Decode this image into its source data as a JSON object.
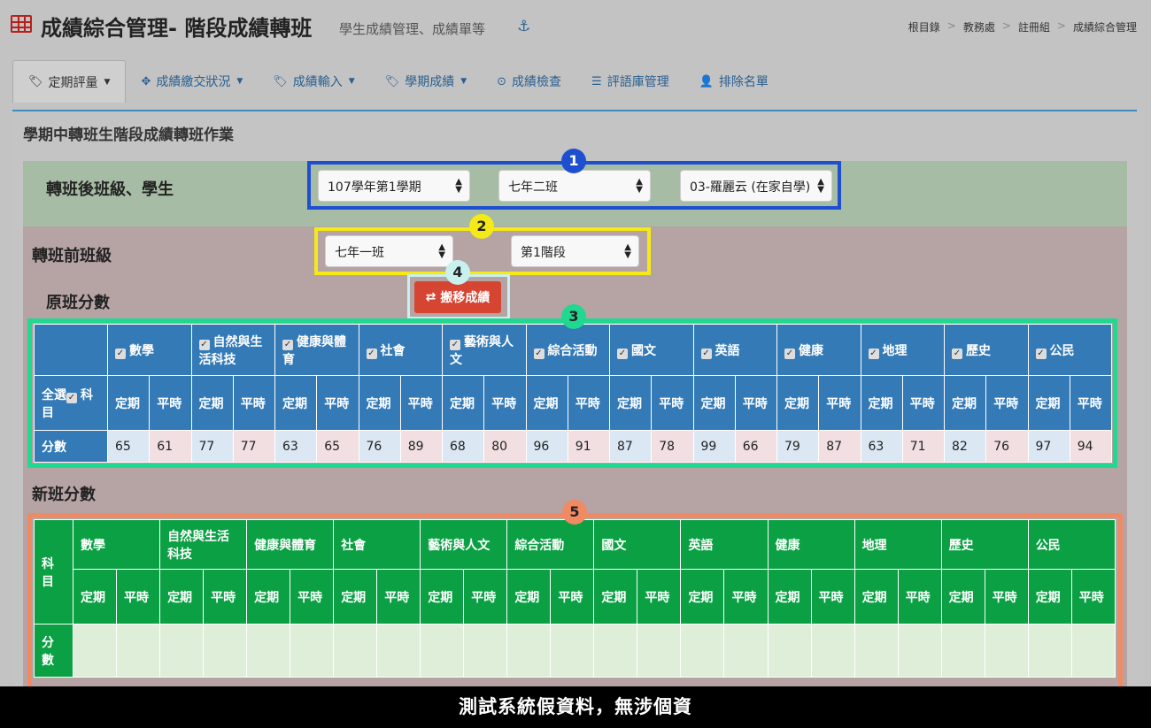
{
  "header": {
    "title": "成績綜合管理- 階段成績轉班",
    "subtitle": "學生成績管理、成績單等",
    "anchor_icon": "anchor-icon",
    "breadcrumb": [
      "根目錄",
      "教務處",
      "註冊組",
      "成績綜合管理"
    ]
  },
  "tabs": [
    {
      "label": "定期評量",
      "icon": "tags-icon",
      "dropdown": true,
      "active": true
    },
    {
      "label": "成績繳交狀況",
      "icon": "crosshairs-icon",
      "dropdown": true
    },
    {
      "label": "成績輸入",
      "icon": "tags-icon",
      "dropdown": true
    },
    {
      "label": "學期成績",
      "icon": "tags-icon",
      "dropdown": true
    },
    {
      "label": "成績檢查",
      "icon": "check-circle-icon",
      "dropdown": false
    },
    {
      "label": "評語庫管理",
      "icon": "database-icon",
      "dropdown": false
    },
    {
      "label": "排除名單",
      "icon": "user-times-icon",
      "dropdown": false
    }
  ],
  "panel": {
    "title": "學期中轉班生階段成績轉班作業",
    "after_label": "轉班後班級、學生",
    "after_selects": [
      "107學年第1學期",
      "七年二班",
      "03-羅麗云 (在家自學)"
    ],
    "before_label": "轉班前班級",
    "before_selects": [
      "七年一班",
      "第1階段"
    ],
    "move_button": "搬移成績",
    "original_label": "原班分數",
    "new_label": "新班分數"
  },
  "badges": [
    "1",
    "2",
    "3",
    "4",
    "5"
  ],
  "original_table": {
    "select_all": "全選",
    "subject_header": "科目",
    "score_label": "分數",
    "subjects": [
      "數學",
      "自然與生活科技",
      "健康與體育",
      "社會",
      "藝術與人文",
      "綜合活動",
      "國文",
      "英語",
      "健康",
      "地理",
      "歷史",
      "公民"
    ],
    "sub_headers": [
      "定期",
      "平時"
    ],
    "scores": [
      65,
      61,
      77,
      77,
      63,
      65,
      76,
      89,
      68,
      80,
      96,
      91,
      87,
      78,
      99,
      66,
      79,
      87,
      63,
      71,
      82,
      76,
      97,
      94
    ]
  },
  "new_table": {
    "subject_header": "科目",
    "score_label": "分數",
    "subjects": [
      "數學",
      "自然與生活科技",
      "健康與體育",
      "社會",
      "藝術與人文",
      "綜合活動",
      "國文",
      "英語",
      "健康",
      "地理",
      "歷史",
      "公民"
    ],
    "sub_headers": [
      "定期",
      "平時"
    ]
  },
  "footer_note": "測試系統假資料，無涉個資",
  "colors": {
    "box1": "#1f4fd1",
    "box2": "#f5ea16",
    "box3": "#1ed98f",
    "box4": "#c8f0ef",
    "box5": "#f08a63",
    "table1_header": "#337ab7",
    "table2_header": "#0aa043",
    "move_button": "#d64432"
  }
}
